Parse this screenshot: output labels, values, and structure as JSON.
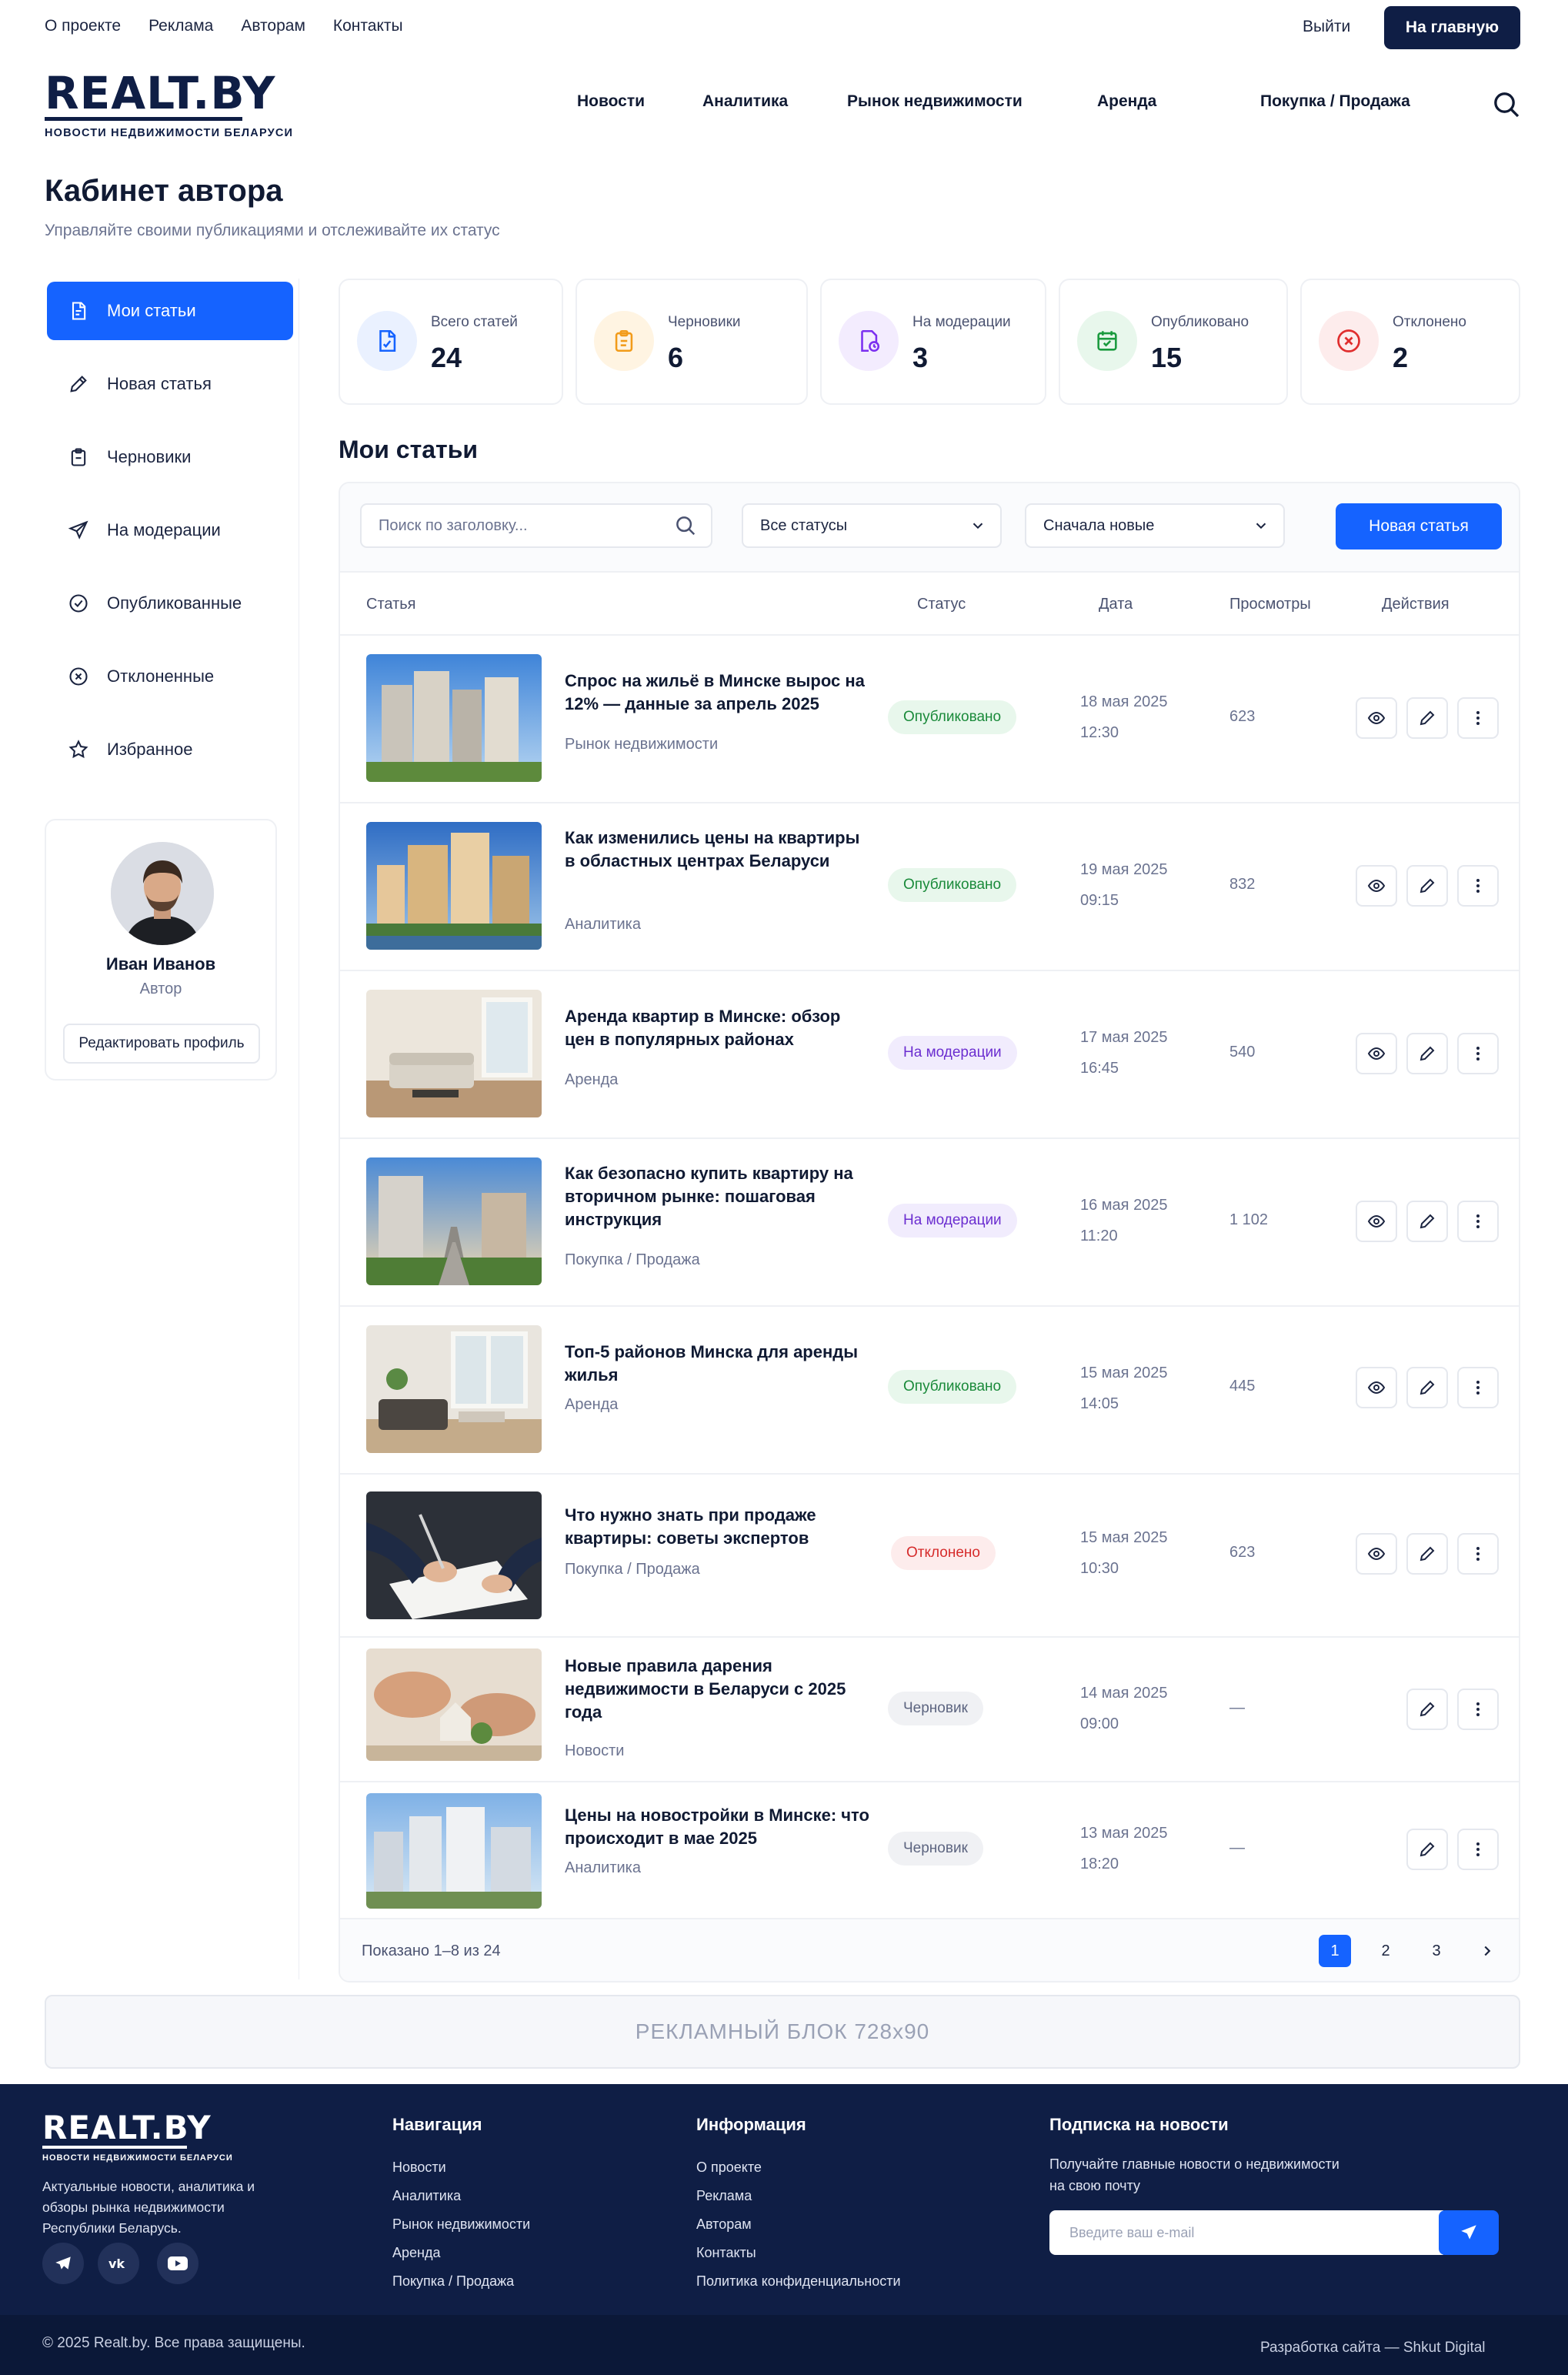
{
  "topbar": {
    "links": [
      "О проекте",
      "Реклама",
      "Авторам",
      "Контакты"
    ],
    "logout": "Выйти",
    "home_button": "На главную"
  },
  "header": {
    "logo_main": "REALT.BY",
    "logo_sub": "НОВОСТИ НЕДВИЖИМОСТИ БЕЛАРУСИ",
    "nav": [
      "Новости",
      "Аналитика",
      "Рынок недвижимости",
      "Аренда",
      "Покупка / Продажа"
    ]
  },
  "page": {
    "title": "Кабинет автора",
    "subtitle": "Управляйте своими публикациями и отслеживайте их статус"
  },
  "sidebar": {
    "items": [
      {
        "label": "Мои статьи",
        "icon": "article-icon",
        "active": true
      },
      {
        "label": "Новая статья",
        "icon": "pencil-icon"
      },
      {
        "label": "Черновики",
        "icon": "clipboard-icon"
      },
      {
        "label": "На модерации",
        "icon": "send-icon"
      },
      {
        "label": "Опубликованные",
        "icon": "check-circle-icon"
      },
      {
        "label": "Отклоненные",
        "icon": "x-circle-icon"
      },
      {
        "label": "Избранное",
        "icon": "star-icon"
      }
    ]
  },
  "profile": {
    "name": "Иван Иванов",
    "role": "Автор",
    "edit_button": "Редактировать профиль"
  },
  "stats": [
    {
      "label": "Всего статей",
      "value": "24",
      "color": "#1563ff"
    },
    {
      "label": "Черновики",
      "value": "6",
      "color": "#f29b1a"
    },
    {
      "label": "На модерации",
      "value": "3",
      "color": "#7b2ff0"
    },
    {
      "label": "Опубликовано",
      "value": "15",
      "color": "#1a9a3e"
    },
    {
      "label": "Отклонено",
      "value": "2",
      "color": "#e02e2e"
    }
  ],
  "articles": {
    "section_title": "Мои статьи",
    "search_placeholder": "Поиск по заголовку...",
    "status_filter": "Все статусы",
    "sort": "Сначала новые",
    "new_button": "Новая статья",
    "columns": [
      "Статья",
      "Статус",
      "Дата",
      "Просмотры",
      "Действия"
    ],
    "rows": [
      {
        "title": "Спрос на жильё в Минске вырос на 12% — данные за апрель 2025",
        "category": "Рынок недвижимости",
        "status": "Опубликовано",
        "status_type": "pub",
        "date": "18 мая 2025",
        "time": "12:30",
        "views": "623"
      },
      {
        "title": "Как изменились цены на квартиры в областных центрах Беларуси",
        "category": "Аналитика",
        "status": "Опубликовано",
        "status_type": "pub",
        "date": "19 мая 2025",
        "time": "09:15",
        "views": "832"
      },
      {
        "title": "Аренда квартир в Минске: обзор цен в популярных районах",
        "category": "Аренда",
        "status": "На модерации",
        "status_type": "mod",
        "date": "17 мая 2025",
        "time": "16:45",
        "views": "540"
      },
      {
        "title": "Как безопасно купить квартиру на вторичном рынке: пошаговая инструкция",
        "category": "Покупка / Продажа",
        "status": "На модерации",
        "status_type": "mod",
        "date": "16 мая 2025",
        "time": "11:20",
        "views": "1 102"
      },
      {
        "title": "Топ-5 районов Минска для аренды жилья",
        "category": "Аренда",
        "status": "Опубликовано",
        "status_type": "pub",
        "date": "15 мая 2025",
        "time": "14:05",
        "views": "445"
      },
      {
        "title": "Что нужно знать при продаже квартиры: советы экспертов",
        "category": "Покупка / Продажа",
        "status": "Отклонено",
        "status_type": "rej",
        "date": "15 мая 2025",
        "time": "10:30",
        "views": "623"
      },
      {
        "title": "Новые правила дарения недвижимости в Беларуси с 2025 года",
        "category": "Новости",
        "status": "Черновик",
        "status_type": "draft",
        "date": "14 мая 2025",
        "time": "09:00",
        "views": "—"
      },
      {
        "title": "Цены на новостройки в Минске: что происходит в мае 2025",
        "category": "Аналитика",
        "status": "Черновик",
        "status_type": "draft",
        "date": "13 мая 2025",
        "time": "18:20",
        "views": "—"
      }
    ],
    "shown_text": "Показано 1–8 из 24",
    "pages": [
      "1",
      "2",
      "3"
    ]
  },
  "ad": {
    "text": "РЕКЛАМНЫЙ БЛОК 728x90"
  },
  "footer": {
    "logo_main": "REALT.BY",
    "logo_sub": "НОВОСТИ НЕДВИЖИМОСТИ БЕЛАРУСИ",
    "description": "Актуальные новости, аналитика и обзоры рынка недвижимости Республики Беларусь.",
    "nav_title": "Навигация",
    "nav_links": [
      "Новости",
      "Аналитика",
      "Рынок недвижимости",
      "Аренда",
      "Покупка / Продажа"
    ],
    "info_title": "Информация",
    "info_links": [
      "О проекте",
      "Реклама",
      "Авторам",
      "Контакты",
      "Политика конфиденциальности"
    ],
    "subscribe_title": "Подписка на новости",
    "subscribe_text_1": "Получайте главные новости о недвижимости",
    "subscribe_text_2": "на свою почту",
    "email_placeholder": "Введите ваш e-mail",
    "copyright": "© 2025 Realt.by. Все права защищены.",
    "developer": "Разработка сайта — Shkut Digital"
  }
}
